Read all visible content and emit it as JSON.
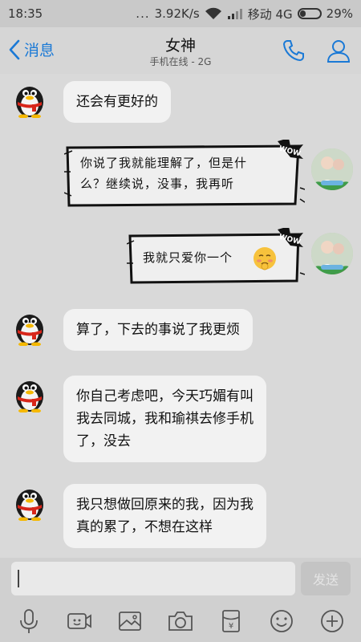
{
  "status_bar": {
    "time": "18:35",
    "speed": "3.92K/s",
    "carrier": "移动 4G",
    "battery_percent": "29%",
    "battery_level": 0.29
  },
  "header": {
    "back_label": "消息",
    "contact_name": "女神",
    "contact_status": "手机在线 - 2G"
  },
  "messages": [
    {
      "side": "left",
      "type": "text",
      "text": "还会有更好的"
    },
    {
      "side": "right",
      "type": "comic",
      "lines": [
        "你说了我就能理解了，但是什",
        "么？继续说，没事，我再听"
      ],
      "badge": "WOW"
    },
    {
      "side": "right",
      "type": "comic",
      "lines": [
        "我就只爱你一个"
      ],
      "badge": "WOW",
      "emoji": "embarrassed-face"
    },
    {
      "side": "left",
      "type": "text",
      "text": "算了，下去的事说了我更烦"
    },
    {
      "side": "left",
      "type": "text",
      "lines": [
        "你自己考虑吧，今天巧媚有叫",
        "我去同城，我和瑜祺去修手机",
        "了，没去"
      ]
    },
    {
      "side": "left",
      "type": "text",
      "lines": [
        "我只想做回原来的我，因为我",
        "真的累了，不想在这样"
      ]
    }
  ],
  "input": {
    "value": "",
    "send_label": "发送"
  },
  "toolbar": {
    "icons": [
      "microphone-icon",
      "video-icon",
      "image-icon",
      "camera-icon",
      "red-packet-icon",
      "emoji-icon",
      "plus-icon"
    ]
  },
  "colors": {
    "accent": "#1a79d6",
    "bubble": "#f2f2f2",
    "background": "#d9d9d9"
  }
}
